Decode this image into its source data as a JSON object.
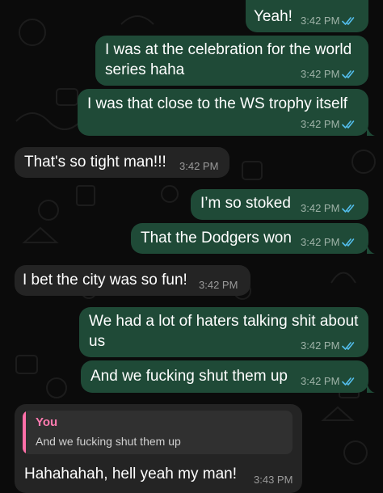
{
  "messages": [
    {
      "text": "Yeah!",
      "time": "3:42 PM",
      "direction": "outgoing",
      "status": "read"
    },
    {
      "text_lines": [
        "I was at the celebration for the world",
        "series haha"
      ],
      "time": "3:42 PM",
      "direction": "outgoing",
      "status": "read"
    },
    {
      "text": "I was that close to the WS trophy itself",
      "time": "3:42 PM",
      "direction": "outgoing",
      "status": "read"
    },
    {
      "text": "That's so tight man!!!",
      "time": "3:42 PM",
      "direction": "incoming"
    },
    {
      "text": "I’m so stoked",
      "time": "3:42 PM",
      "direction": "outgoing",
      "status": "read"
    },
    {
      "text": "That the Dodgers won",
      "time": "3:42 PM",
      "direction": "outgoing",
      "status": "read"
    },
    {
      "text": "I bet the city was so fun!",
      "time": "3:42 PM",
      "direction": "incoming"
    },
    {
      "text_lines": [
        "We had a lot of haters talking shit about",
        "us"
      ],
      "time": "3:42 PM",
      "direction": "outgoing",
      "status": "read"
    },
    {
      "text": "And we fucking shut them up",
      "time": "3:42 PM",
      "direction": "outgoing",
      "status": "read"
    },
    {
      "reply_to": {
        "author": "You",
        "text": "And we fucking shut them up"
      },
      "text": "Hahahahah, hell yeah my man!",
      "time": "3:43 PM",
      "direction": "incoming"
    }
  ],
  "colors": {
    "background": "#0b0b0b",
    "outgoing_bubble": "#1f4a37",
    "incoming_bubble": "#242424",
    "read_ticks": "#53bdeb",
    "reply_accent": "#ff6fa8"
  },
  "icons": {
    "read_status": "double-check-icon",
    "wallpaper": "doodle-pattern"
  }
}
